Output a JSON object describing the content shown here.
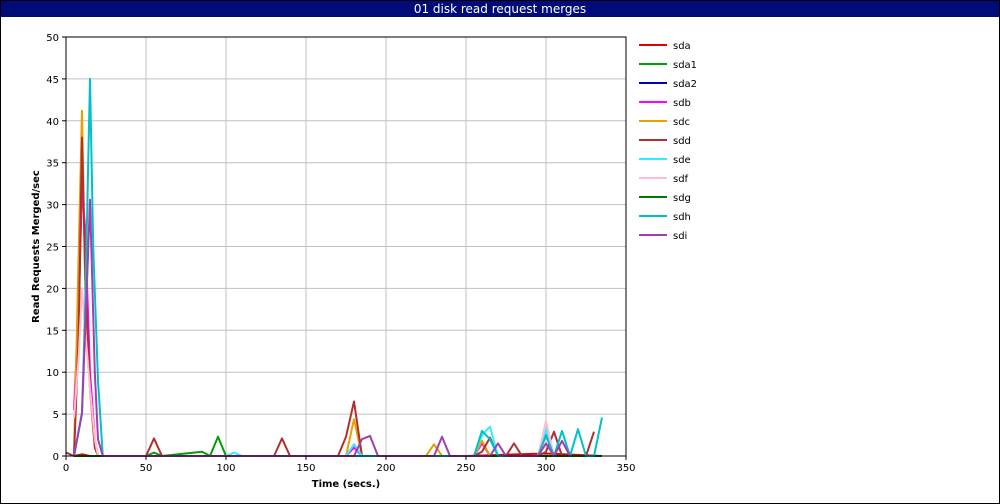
{
  "chart_data": {
    "type": "line",
    "title": "01 disk read request merges",
    "xlabel": "Time (secs.)",
    "ylabel": "Read Requests Merged/sec",
    "xlim": [
      0,
      350
    ],
    "ylim": [
      0,
      50
    ],
    "x_ticks": [
      0,
      50,
      100,
      150,
      200,
      250,
      300,
      350
    ],
    "y_ticks": [
      0,
      5,
      10,
      15,
      20,
      25,
      30,
      35,
      40,
      45,
      50
    ],
    "grid": true,
    "legend_position": "right",
    "series": [
      {
        "name": "sda",
        "color": "#e00000",
        "points": [
          [
            5,
            0
          ],
          [
            10,
            0.2
          ],
          [
            15,
            0
          ],
          [
            50,
            0
          ],
          [
            100,
            0
          ],
          [
            150,
            0
          ],
          [
            200,
            0
          ],
          [
            250,
            0
          ],
          [
            300,
            0.3
          ],
          [
            335,
            0
          ]
        ]
      },
      {
        "name": "sda1",
        "color": "#00a000",
        "points": [
          [
            5,
            0
          ],
          [
            10,
            0
          ],
          [
            50,
            0
          ],
          [
            55,
            0.4
          ],
          [
            60,
            0
          ],
          [
            85,
            0.5
          ],
          [
            90,
            0
          ],
          [
            95,
            2.3
          ],
          [
            100,
            0
          ],
          [
            150,
            0
          ],
          [
            200,
            0
          ],
          [
            250,
            0
          ],
          [
            300,
            0
          ],
          [
            335,
            0
          ]
        ]
      },
      {
        "name": "sda2",
        "color": "#0000c0",
        "points": [
          [
            5,
            0
          ],
          [
            50,
            0
          ],
          [
            100,
            0
          ],
          [
            150,
            0
          ],
          [
            200,
            0
          ],
          [
            250,
            0
          ],
          [
            300,
            0
          ],
          [
            335,
            0
          ]
        ]
      },
      {
        "name": "sdb",
        "color": "#ff00ff",
        "points": [
          [
            5,
            5.5
          ],
          [
            8,
            18
          ],
          [
            10,
            32
          ],
          [
            12,
            27
          ],
          [
            15,
            10
          ],
          [
            18,
            2
          ],
          [
            20,
            0
          ],
          [
            25,
            0
          ],
          [
            50,
            0
          ],
          [
            100,
            0
          ],
          [
            150,
            0
          ],
          [
            175,
            0
          ],
          [
            180,
            1
          ],
          [
            185,
            0
          ],
          [
            200,
            0
          ],
          [
            250,
            0
          ],
          [
            255,
            0
          ],
          [
            260,
            1.5
          ],
          [
            265,
            0
          ],
          [
            295,
            0
          ],
          [
            300,
            2.5
          ],
          [
            305,
            0
          ],
          [
            335,
            0
          ]
        ]
      },
      {
        "name": "sdc",
        "color": "#e8a000",
        "points": [
          [
            5,
            0
          ],
          [
            8,
            25
          ],
          [
            10,
            41.2
          ],
          [
            12,
            20
          ],
          [
            15,
            8
          ],
          [
            18,
            2
          ],
          [
            20,
            0
          ],
          [
            50,
            0
          ],
          [
            100,
            0
          ],
          [
            150,
            0
          ],
          [
            175,
            0
          ],
          [
            180,
            4.4
          ],
          [
            185,
            0
          ],
          [
            225,
            0
          ],
          [
            230,
            1.4
          ],
          [
            235,
            0
          ],
          [
            255,
            0
          ],
          [
            260,
            1.8
          ],
          [
            265,
            0
          ],
          [
            335,
            0
          ]
        ]
      },
      {
        "name": "sdd",
        "color": "#b03030",
        "points": [
          [
            0,
            0.4
          ],
          [
            5,
            0
          ],
          [
            8,
            15
          ],
          [
            10,
            38
          ],
          [
            12,
            22
          ],
          [
            15,
            8
          ],
          [
            18,
            1
          ],
          [
            20,
            0
          ],
          [
            50,
            0
          ],
          [
            55,
            2.1
          ],
          [
            60,
            0
          ],
          [
            130,
            0
          ],
          [
            135,
            2.1
          ],
          [
            140,
            0
          ],
          [
            170,
            0
          ],
          [
            175,
            2.3
          ],
          [
            180,
            6.5
          ],
          [
            185,
            0
          ],
          [
            255,
            0
          ],
          [
            260,
            0.5
          ],
          [
            265,
            2.2
          ],
          [
            270,
            0
          ],
          [
            275,
            0
          ],
          [
            280,
            1.5
          ],
          [
            285,
            0
          ],
          [
            295,
            0
          ],
          [
            300,
            0.5
          ],
          [
            305,
            2.9
          ],
          [
            310,
            0
          ],
          [
            325,
            0
          ],
          [
            330,
            2.9
          ]
        ]
      },
      {
        "name": "sde",
        "color": "#33eeff",
        "points": [
          [
            5,
            0
          ],
          [
            50,
            0
          ],
          [
            100,
            0
          ],
          [
            105,
            0.4
          ],
          [
            110,
            0
          ],
          [
            175,
            0
          ],
          [
            180,
            1.4
          ],
          [
            185,
            0
          ],
          [
            255,
            0
          ],
          [
            260,
            2.5
          ],
          [
            265,
            3.5
          ],
          [
            270,
            0
          ],
          [
            295,
            0
          ],
          [
            300,
            3.2
          ],
          [
            305,
            0
          ],
          [
            335,
            0
          ]
        ]
      },
      {
        "name": "sdf",
        "color": "#ffbfcf",
        "points": [
          [
            5,
            4.5
          ],
          [
            8,
            12
          ],
          [
            10,
            20
          ],
          [
            12,
            15
          ],
          [
            15,
            8
          ],
          [
            18,
            2
          ],
          [
            20,
            0
          ],
          [
            50,
            0
          ],
          [
            100,
            0
          ],
          [
            150,
            0
          ],
          [
            200,
            0
          ],
          [
            250,
            0
          ],
          [
            295,
            0
          ],
          [
            300,
            4.2
          ],
          [
            305,
            0
          ],
          [
            335,
            0
          ]
        ]
      },
      {
        "name": "sdg",
        "color": "#007a00",
        "points": [
          [
            5,
            0
          ],
          [
            50,
            0
          ],
          [
            100,
            0
          ],
          [
            150,
            0
          ],
          [
            200,
            0
          ],
          [
            250,
            0
          ],
          [
            300,
            0
          ],
          [
            335,
            0
          ]
        ]
      },
      {
        "name": "sdh",
        "color": "#00c0cc",
        "points": [
          [
            5,
            0
          ],
          [
            10,
            5
          ],
          [
            12,
            18
          ],
          [
            15,
            45
          ],
          [
            17,
            25
          ],
          [
            20,
            9
          ],
          [
            23,
            0
          ],
          [
            50,
            0
          ],
          [
            100,
            0
          ],
          [
            150,
            0
          ],
          [
            200,
            0
          ],
          [
            250,
            0
          ],
          [
            255,
            0
          ],
          [
            260,
            3
          ],
          [
            265,
            2
          ],
          [
            270,
            0
          ],
          [
            295,
            0
          ],
          [
            300,
            2.5
          ],
          [
            305,
            0
          ],
          [
            310,
            3
          ],
          [
            315,
            0
          ],
          [
            320,
            3.2
          ],
          [
            325,
            0
          ],
          [
            330,
            0
          ],
          [
            335,
            4.6
          ]
        ]
      },
      {
        "name": "sdi",
        "color": "#a040b0",
        "points": [
          [
            5,
            0
          ],
          [
            10,
            5.2
          ],
          [
            13,
            20
          ],
          [
            15,
            30.6
          ],
          [
            18,
            10
          ],
          [
            20,
            2
          ],
          [
            23,
            0
          ],
          [
            50,
            0
          ],
          [
            100,
            0
          ],
          [
            150,
            0
          ],
          [
            180,
            0
          ],
          [
            185,
            2
          ],
          [
            190,
            2.4
          ],
          [
            195,
            0
          ],
          [
            230,
            0
          ],
          [
            235,
            2.3
          ],
          [
            240,
            0
          ],
          [
            265,
            0
          ],
          [
            270,
            1.5
          ],
          [
            275,
            0
          ],
          [
            295,
            0
          ],
          [
            300,
            1.5
          ],
          [
            305,
            0
          ],
          [
            310,
            1.8
          ],
          [
            315,
            0
          ]
        ]
      }
    ]
  }
}
